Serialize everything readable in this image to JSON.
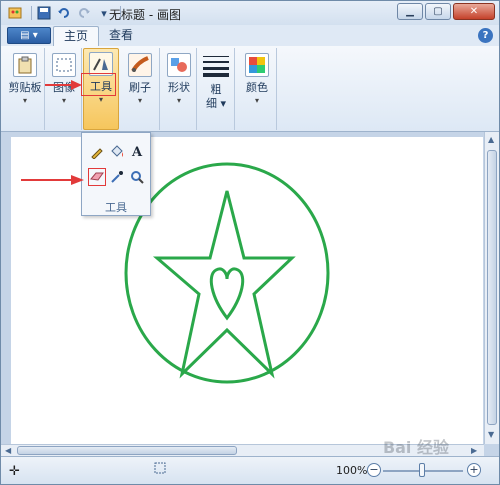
{
  "window": {
    "title": "无标题 - 画图"
  },
  "tabs": [
    "主页",
    "查看"
  ],
  "ribbon": {
    "clipboard_label": "剪贴板",
    "image_label": "图像",
    "tools_label": "工具",
    "brushes_label": "刷子",
    "shapes_label": "形状",
    "size_label_top": "粗",
    "size_label_bottom": "细",
    "colors_label": "颜色"
  },
  "tools_dropdown": {
    "label": "工具",
    "items": [
      "pencil-icon",
      "fill-icon",
      "text-icon",
      "eraser-icon",
      "color-picker-icon",
      "magnifier-icon"
    ],
    "text_glyph": "A"
  },
  "canvas": {
    "stroke_color": "#2aa84a"
  },
  "status": {
    "zoom": "100%"
  },
  "watermark": "Bai 经验"
}
